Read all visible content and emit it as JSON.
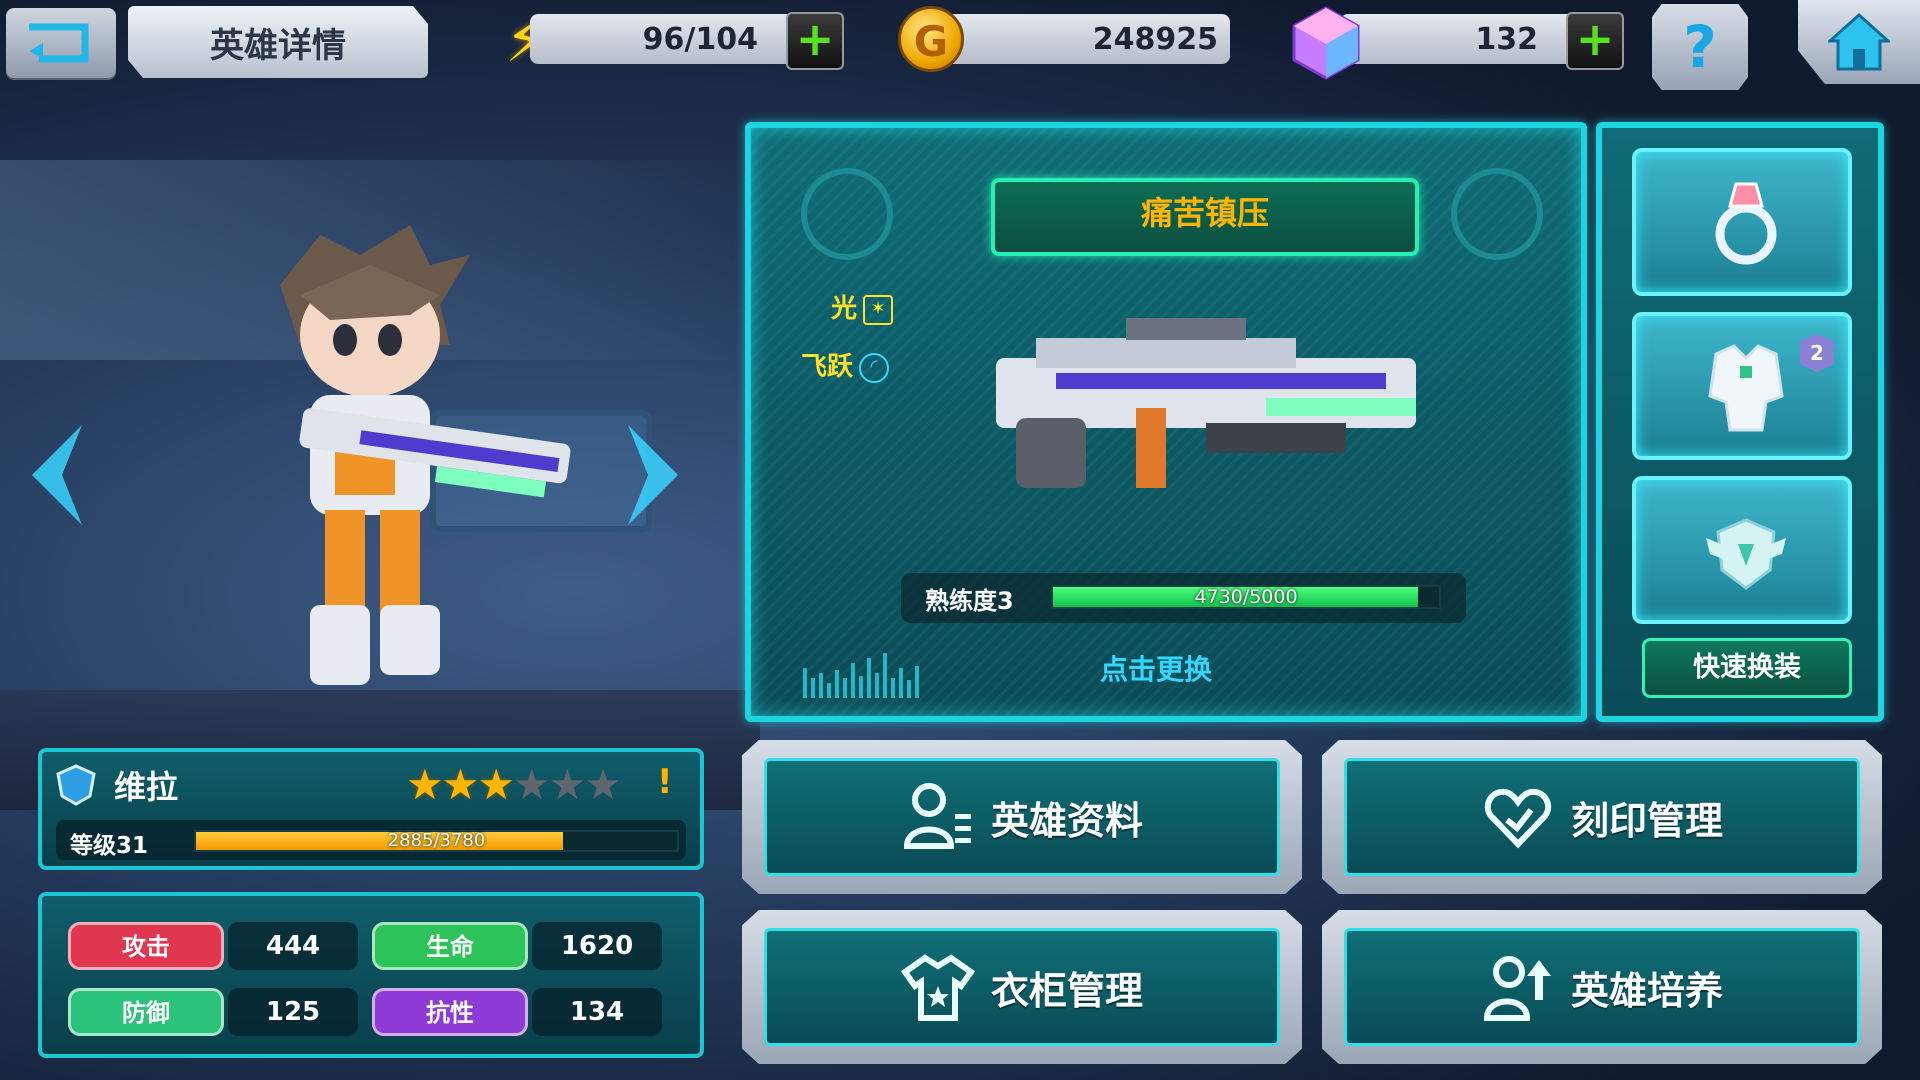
{
  "header": {
    "title": "英雄详情",
    "energy": "96/104",
    "gold": "248925",
    "gold_icon": "G",
    "gems": "132",
    "help_label": "?"
  },
  "weapon": {
    "name": "痛苦镇压",
    "element_label": "光",
    "move_label": "飞跃",
    "mastery_label": "熟练度3",
    "mastery_text": "4730/5000",
    "mastery_fraction": 0.946,
    "change_label": "点击更换"
  },
  "equipment": {
    "slot2_badge": "2",
    "quick_change_label": "快速换装"
  },
  "hero": {
    "name": "维拉",
    "stars_filled": 3,
    "stars_total": 6,
    "alert": "!",
    "level_label": "等级31",
    "exp_text": "2885/3780",
    "exp_fraction": 0.763
  },
  "stats": {
    "attack_label": "攻击",
    "attack": "444",
    "hp_label": "生命",
    "hp": "1620",
    "defense_label": "防御",
    "defense": "125",
    "resist_label": "抗性",
    "resist": "134"
  },
  "menu": {
    "profile": "英雄资料",
    "imprint": "刻印管理",
    "wardrobe": "衣柜管理",
    "training": "英雄培养"
  },
  "colors": {
    "panel_border": "#1bd6e0",
    "weapon_name": "#ffb400",
    "mastery_bar": "#1fd45a",
    "exp_bar": "#f5a800",
    "attack": "#e0364f",
    "hp": "#2cc35a",
    "defense": "#2bc27a",
    "resist": "#8e3ad6"
  },
  "icons": {
    "back": "back-arrow-icon",
    "energy": "lightning-icon",
    "gold": "gold-coin-icon",
    "gem": "crystal-gem-icon",
    "help": "question-icon",
    "home": "home-icon"
  }
}
